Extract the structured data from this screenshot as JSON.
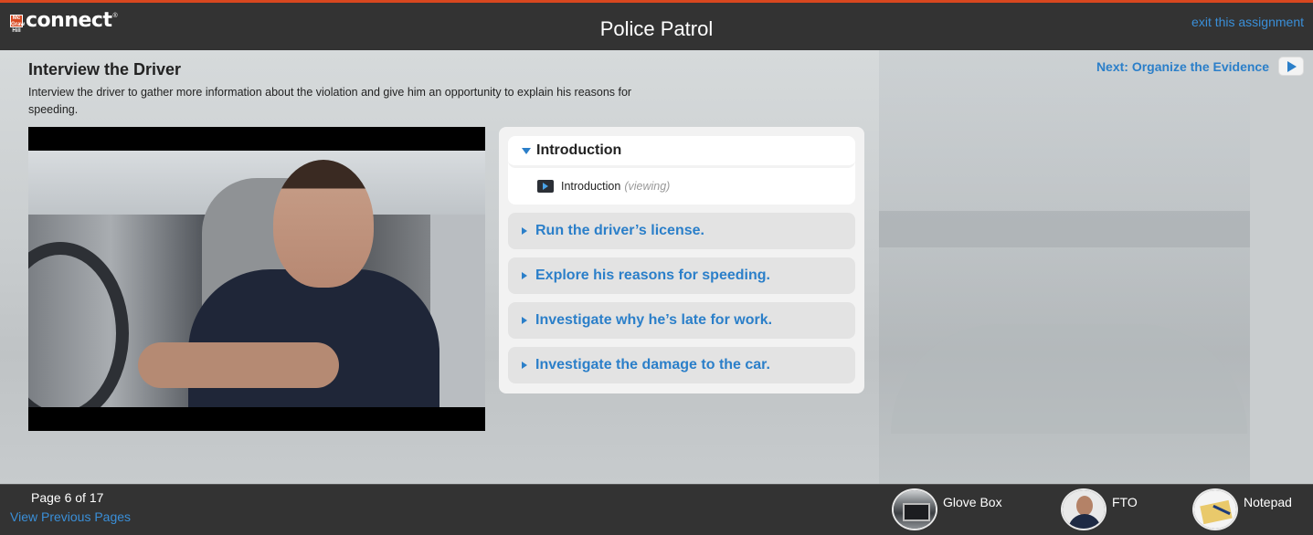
{
  "header": {
    "logo_text": "connect",
    "logo_mark": "Mc Graw Hill",
    "title": "Police Patrol",
    "exit_label": "exit this assignment"
  },
  "page": {
    "heading": "Interview the Driver",
    "description": "Interview the driver to gather more information about the violation and give him an opportunity to explain his reasons for speeding.",
    "next_label": "Next: Organize the Evidence"
  },
  "menu": {
    "open_section": {
      "label": "Introduction",
      "sub_item": {
        "label": "Introduction",
        "state": "(viewing)"
      }
    },
    "items": [
      {
        "label": "Run the driver’s license."
      },
      {
        "label": "Explore his reasons for speeding."
      },
      {
        "label": "Investigate why he’s late for work."
      },
      {
        "label": "Investigate the damage to the car."
      }
    ]
  },
  "footer": {
    "page_indicator": "Page 6 of 17",
    "prev_link": "View Previous Pages",
    "tools": [
      {
        "label": "Glove Box",
        "icon": "glove-box-icon"
      },
      {
        "label": "FTO",
        "icon": "fto-avatar-icon"
      },
      {
        "label": "Notepad",
        "icon": "notepad-icon"
      }
    ]
  },
  "colors": {
    "accent": "#d8471f",
    "link": "#2b7fc9",
    "bar": "#333333"
  }
}
